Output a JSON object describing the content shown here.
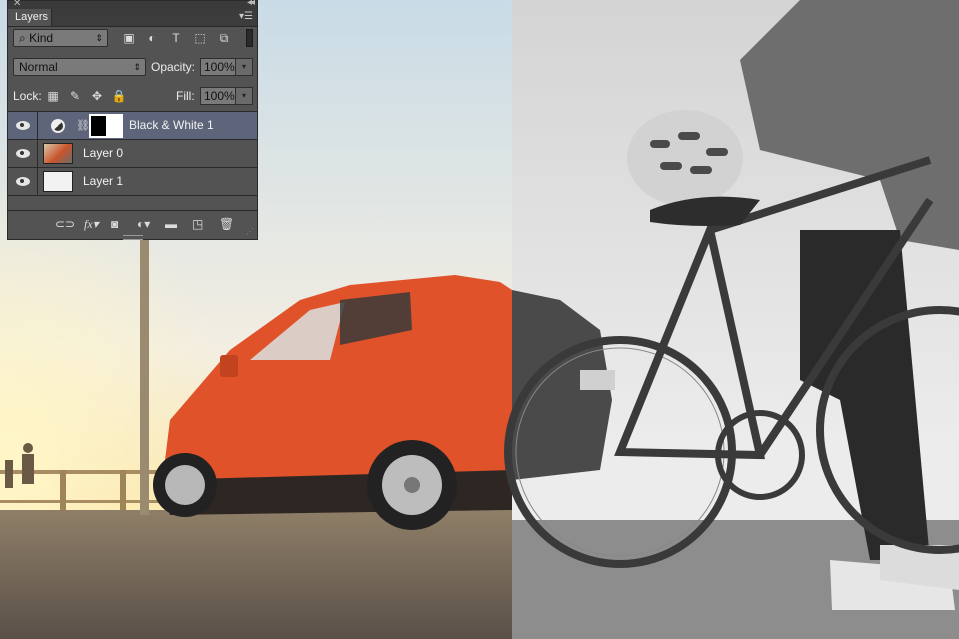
{
  "panel": {
    "tab_label": "Layers",
    "menu_icon": "panel-menu-icon",
    "filter": {
      "kind_label": "Kind",
      "icons": [
        "pixel-filter-icon",
        "adjustment-filter-icon",
        "type-filter-icon",
        "shape-filter-icon",
        "smart-object-filter-icon"
      ]
    },
    "blend_mode": "Normal",
    "opacity_label": "Opacity:",
    "opacity_value": "100%",
    "lock_label": "Lock:",
    "fill_label": "Fill:",
    "fill_value": "100%",
    "layers": [
      {
        "name": "Black & White 1",
        "selected": true,
        "type": "adjustment"
      },
      {
        "name": "Layer 0",
        "selected": false,
        "type": "image"
      },
      {
        "name": "Layer 1",
        "selected": false,
        "type": "blank"
      }
    ],
    "footer_icons": [
      "link-layers-icon",
      "fx-icon",
      "add-mask-icon",
      "new-adjustment-icon",
      "new-group-icon",
      "new-layer-icon",
      "delete-layer-icon"
    ],
    "fx_text": "fx"
  },
  "colors": {
    "panel_bg": "#535353",
    "selected_row": "#5e6479",
    "car": "#e0522a"
  }
}
